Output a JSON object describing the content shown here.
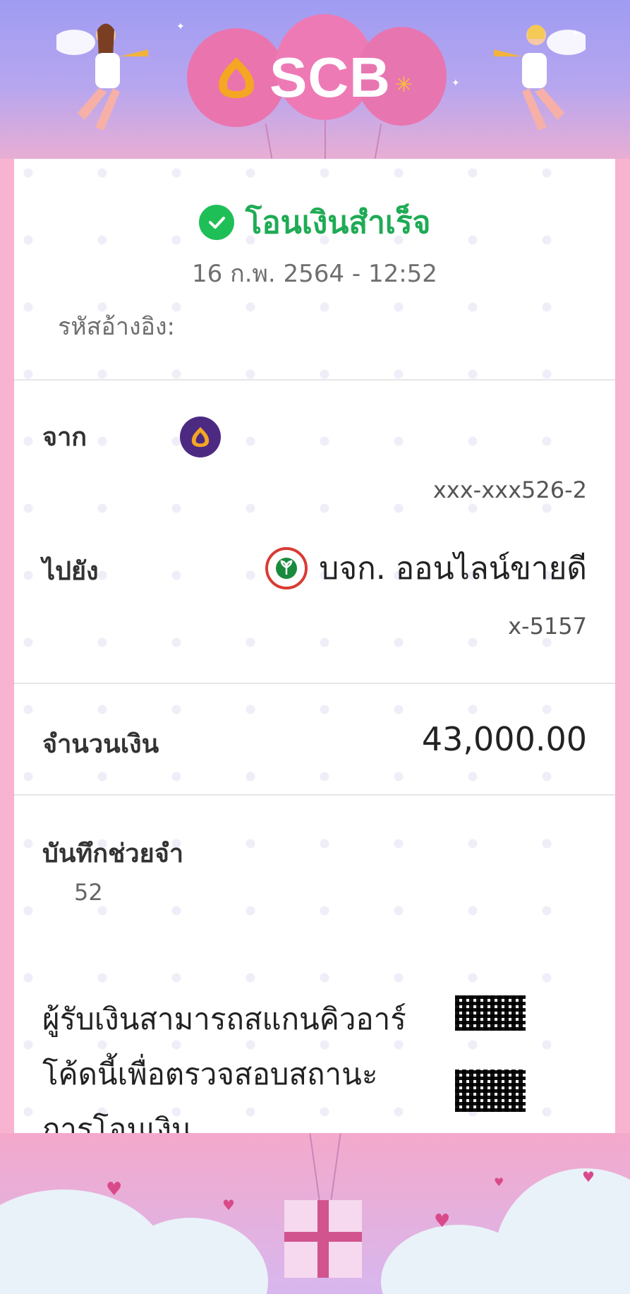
{
  "header": {
    "brand": "SCB",
    "colors": {
      "balloon": "#ea79b0",
      "sky_top": "#9f9cf2",
      "logo_gold": "#f5a623"
    }
  },
  "receipt": {
    "status": "โอนเงินสำเร็จ",
    "datetime": "16 ก.พ. 2564 - 12:52",
    "ref_label": "รหัสอ้างอิง:",
    "from_label": "จาก",
    "from_account": "xxx-xxx526-2",
    "to_label": "ไปยัง",
    "to_name": "บจก. ออนไลน์ขายดี",
    "to_account": "x-5157",
    "amount_label": "จำนวนเงิน",
    "amount": "43,000.00",
    "memo_label": "บันทึกช่วยจำ",
    "memo_value": "52",
    "qr_text": "ผู้รับเงินสามารถสแกนคิวอาร์โค้ดนี้เพื่อตรวจสอบสถานะการโอนเงิน"
  },
  "icons": {
    "success": "check-circle-icon",
    "from_bank": "scb-logo-icon",
    "to_bank": "kbank-logo-icon",
    "qr": "qr-code-icon"
  },
  "colors": {
    "success_green": "#1fab55",
    "frame_pink": "#f7b3cf"
  }
}
